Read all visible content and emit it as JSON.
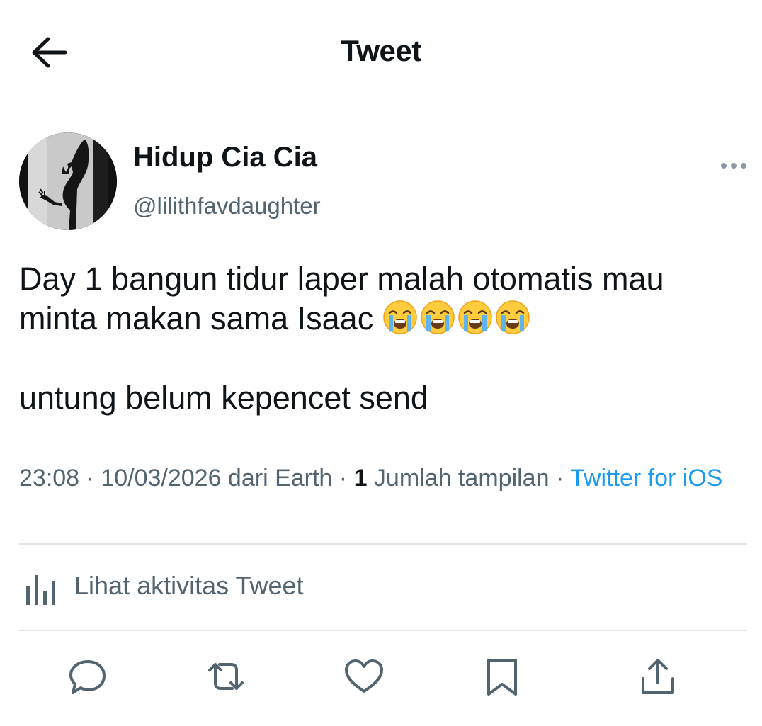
{
  "header": {
    "title": "Tweet",
    "back_icon": "arrow-left-icon"
  },
  "author": {
    "name": "Hidup Cia Cia",
    "handle": "@lilithfavdaughter",
    "avatar_icon": "devil-silhouette-avatar"
  },
  "tweet": {
    "line1": "Day 1 bangun tidur laper malah otomatis mau",
    "line2": "minta makan sama Isaac",
    "emojis": [
      "loudly-crying-face",
      "loudly-crying-face",
      "loudly-crying-face",
      "loudly-crying-face"
    ],
    "line3": "untung belum kepencet send"
  },
  "meta": {
    "time": "23:08",
    "sep1": " · ",
    "date": "10/03/2026",
    "from": " dari Earth",
    "sep2": " · ",
    "views_count": "1",
    "views_label": " Jumlah tampilan",
    "sep3": " · ",
    "source": "Twitter for iOS"
  },
  "activity": {
    "label": "Lihat aktivitas Tweet",
    "icon": "analytics-bars-icon"
  },
  "actions": {
    "reply_icon": "reply-icon",
    "retweet_icon": "retweet-icon",
    "like_icon": "heart-icon",
    "bookmark_icon": "bookmark-icon",
    "share_icon": "share-icon"
  },
  "colors": {
    "text": "#0f1419",
    "muted": "#536471",
    "link": "#1d9bf0",
    "divider": "#e1e5e8"
  }
}
